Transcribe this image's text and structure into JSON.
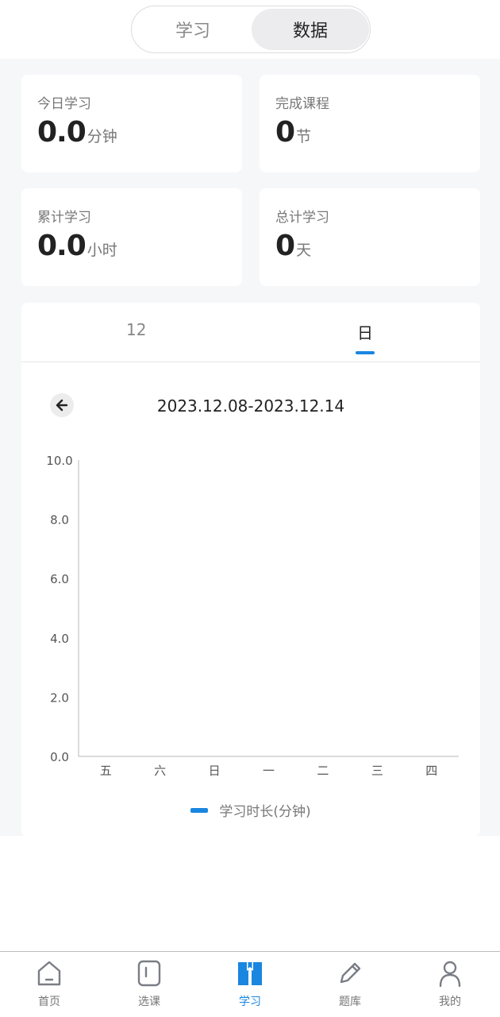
{
  "segment": {
    "tabs": [
      "学习",
      "数据"
    ],
    "active": 1
  },
  "stats": [
    {
      "label": "今日学习",
      "value": "0.0",
      "unit": "分钟"
    },
    {
      "label": "完成课程",
      "value": "0",
      "unit": "节"
    },
    {
      "label": "累计学习",
      "value": "0.0",
      "unit": "小时"
    },
    {
      "label": "总计学习",
      "value": "0",
      "unit": "天"
    }
  ],
  "chart_tabs": [
    "12",
    "日"
  ],
  "date_range": "2023.12.08-2023.12.14",
  "colors": {
    "accent": "#1a86e0",
    "inactive": "#888888",
    "background": "#f6f7f9"
  },
  "chart_data": {
    "type": "bar",
    "categories": [
      "五",
      "六",
      "日",
      "一",
      "二",
      "三",
      "四"
    ],
    "series": [
      {
        "name": "学习时长(分钟)",
        "values": [
          0,
          0,
          0,
          0,
          0,
          0,
          0
        ]
      }
    ],
    "yticks": [
      "0.0",
      "2.0",
      "4.0",
      "6.0",
      "8.0",
      "10.0"
    ],
    "ylim": [
      0,
      10
    ],
    "grid": false,
    "legend": "bottom-center"
  },
  "nav": {
    "items": [
      {
        "label": "首页",
        "icon": "home-icon"
      },
      {
        "label": "选课",
        "icon": "course-icon"
      },
      {
        "label": "学习",
        "icon": "book-icon"
      },
      {
        "label": "题库",
        "icon": "pencil-icon"
      },
      {
        "label": "我的",
        "icon": "user-icon"
      }
    ],
    "active": 2
  }
}
